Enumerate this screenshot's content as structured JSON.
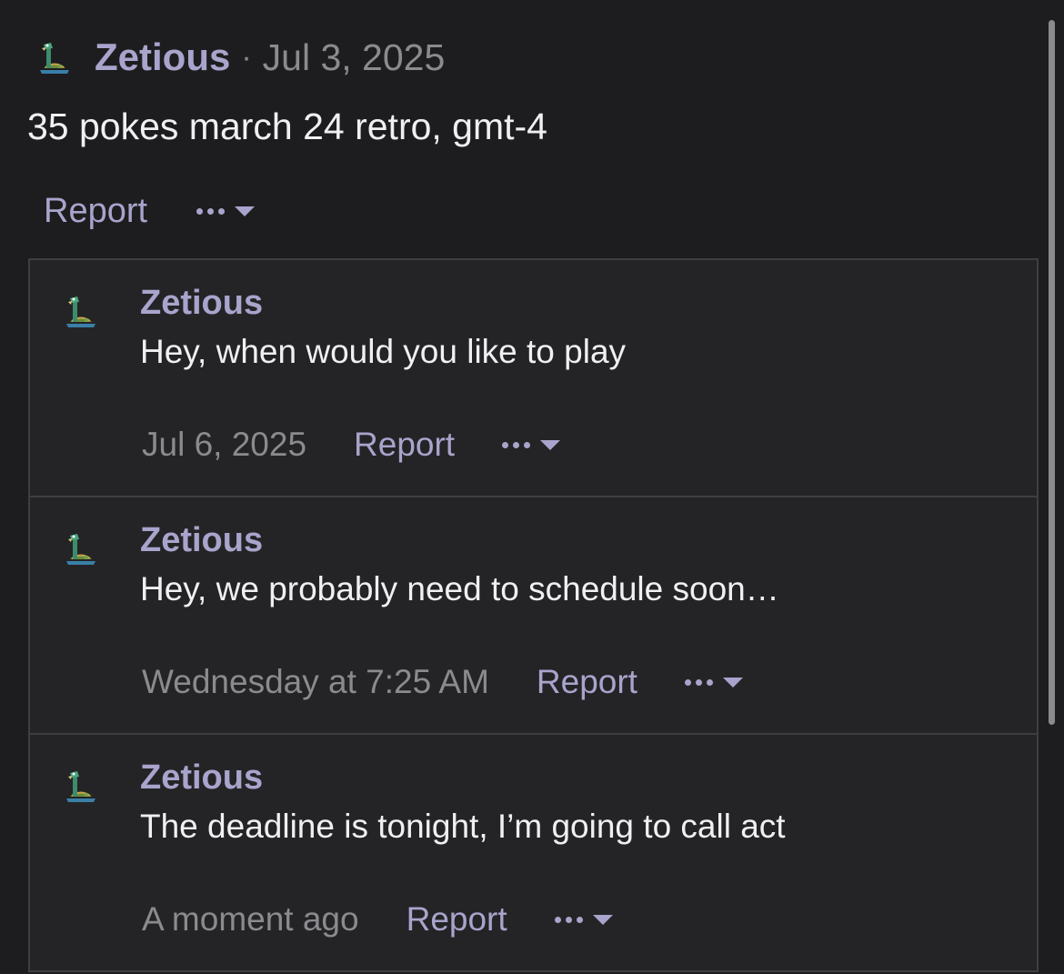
{
  "post": {
    "author": "Zetious",
    "separator": "·",
    "date": "Jul 3, 2025",
    "body": "35 pokes march 24 retro, gmt-4",
    "report_label": "Report",
    "avatar_icon": "pokemon-sprite-avatar",
    "more_icon": "ellipsis-dropdown-icon"
  },
  "replies": [
    {
      "author": "Zetious",
      "text": "Hey, when would you like to play",
      "time": "Jul 6, 2025",
      "report_label": "Report"
    },
    {
      "author": "Zetious",
      "text": "Hey, we probably need to schedule soon…",
      "time": "Wednesday at 7:25 AM",
      "report_label": "Report"
    },
    {
      "author": "Zetious",
      "text": "The deadline is tonight, I’m going to call act",
      "time": "A moment ago",
      "report_label": "Report"
    }
  ],
  "colors": {
    "background": "#1d1d1f",
    "reply_background": "#242426",
    "border": "#3e3e42",
    "accent": "#a8a4cc",
    "muted": "#8b8b8f",
    "text": "#f0f0f2"
  }
}
